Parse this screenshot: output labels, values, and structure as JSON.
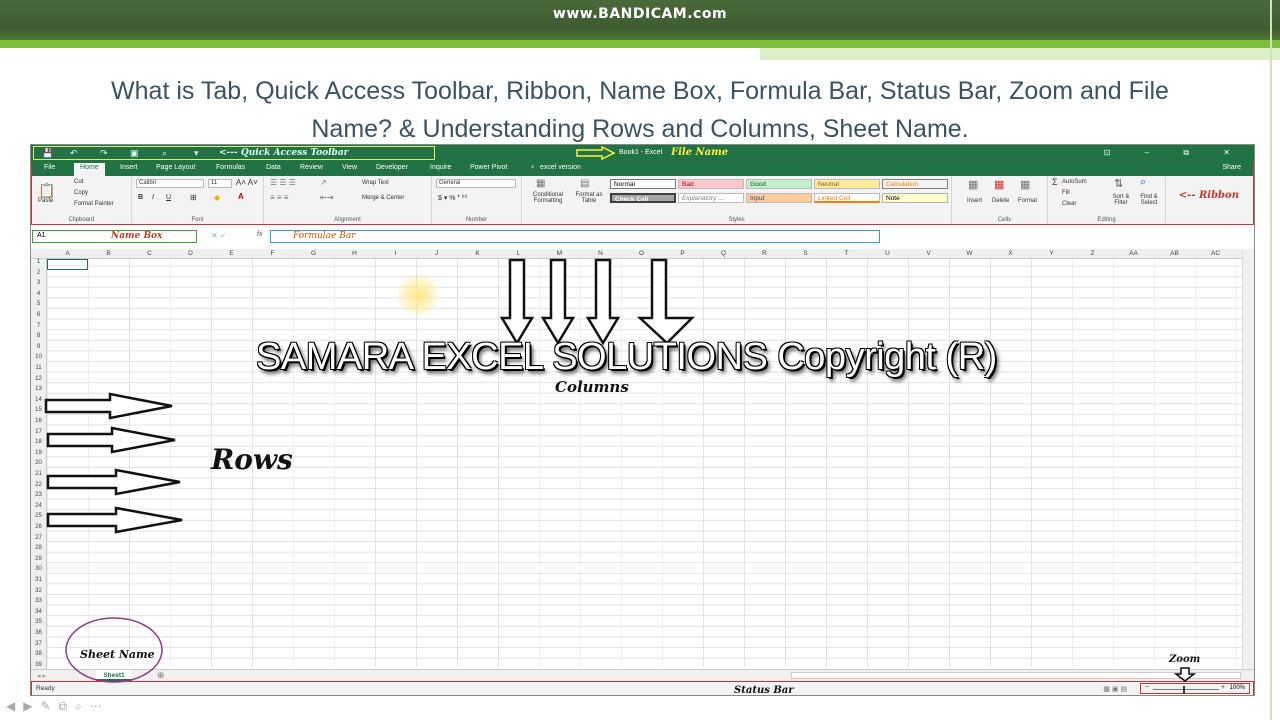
{
  "watermark": "www.BANDICAM.com",
  "heading": {
    "line1": "What is Tab, Quick Access Toolbar, Ribbon, Name Box, Formula Bar, Status Bar, Zoom and File",
    "line2": "Name? & Understanding Rows and Columns, Sheet Name."
  },
  "excel": {
    "qat_label": "<--- Quick Access Toolbar",
    "book_title": "Book1 - Excel",
    "file_name_label": "File Name",
    "window_controls": "⊡ – ⧉ ✕",
    "tabs": [
      "File",
      "Home",
      "Insert",
      "Page Layout",
      "Formulas",
      "Data",
      "Review",
      "View",
      "Developer",
      "Inquire",
      "Power Pivot",
      "excel version"
    ],
    "share": "Share",
    "ribbon_label": "<-- Ribbon",
    "clipboard": {
      "paste": "Paste",
      "cut": "Cut",
      "copy": "Copy",
      "format_painter": "Format Painter",
      "label": "Clipboard"
    },
    "font": {
      "name": "Calibri",
      "size": "11",
      "label": "Font"
    },
    "alignment": {
      "wrap": "Wrap Text",
      "merge": "Merge & Center",
      "label": "Alignment"
    },
    "number": {
      "format": "General",
      "label": "Number"
    },
    "styles": {
      "conditional": "Conditional Formatting",
      "format_table": "Format as Table",
      "normal": "Normal",
      "bad": "Bad",
      "good": "Good",
      "neutral": "Neutral",
      "calculation": "Calculation",
      "check_cell": "Check Cell",
      "explanatory": "Explanatory ...",
      "input": "Input",
      "linked_cell": "Linked Cell",
      "note": "Note",
      "label": "Styles"
    },
    "cells": {
      "insert": "Insert",
      "delete": "Delete",
      "format": "Format",
      "label": "Cells"
    },
    "editing": {
      "autosum": "AutoSum",
      "fill": "Fill",
      "clear": "Clear",
      "sort": "Sort & Filter",
      "find": "Find & Select",
      "label": "Editing"
    },
    "name_box": "A1",
    "name_box_label": "Name Box",
    "formula_label": "Formulae Bar",
    "columns": [
      "A",
      "B",
      "C",
      "D",
      "E",
      "F",
      "G",
      "H",
      "I",
      "J",
      "K",
      "L",
      "M",
      "N",
      "O",
      "P",
      "Q",
      "R",
      "S",
      "T",
      "U",
      "V",
      "W",
      "X",
      "Y",
      "Z",
      "AA",
      "AB",
      "AC"
    ],
    "rows": [
      "1",
      "2",
      "3",
      "4",
      "5",
      "6",
      "7",
      "8",
      "9",
      "10",
      "11",
      "12",
      "13",
      "14",
      "15",
      "16",
      "17",
      "18",
      "19",
      "20",
      "21",
      "22",
      "23",
      "24",
      "25",
      "26",
      "27",
      "28",
      "29",
      "30",
      "31",
      "32",
      "33",
      "34",
      "35",
      "36",
      "37",
      "38",
      "39"
    ],
    "sheet_tab": "Sheet1",
    "sheet_name_label": "Sheet Name",
    "status_ready": "Ready",
    "status_label": "Status Bar",
    "zoom_label": "Zoom",
    "zoom_pct": "100%"
  },
  "overlay": {
    "copyright": "SAMARA EXCEL SOLUTIONS Copyright (R)",
    "columns_label": "Columns",
    "rows_label": "Rows"
  }
}
